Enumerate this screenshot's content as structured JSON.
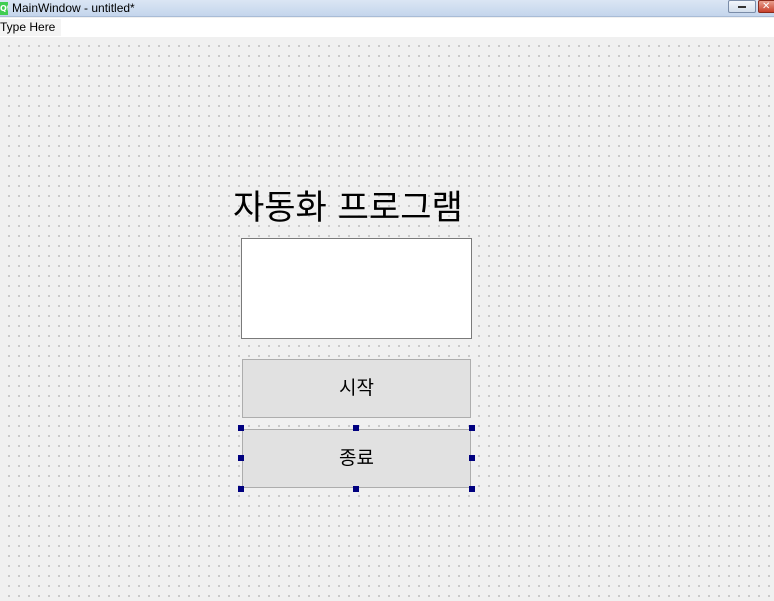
{
  "window": {
    "title": "MainWindow - untitled*",
    "app_icon_text": "Qt"
  },
  "menubar": {
    "placeholder_item": "Type Here"
  },
  "form": {
    "heading": "자동화 프로그램",
    "start_button": "시작",
    "exit_button": "종료"
  },
  "colors": {
    "selection_handle": "#00007f",
    "button_face": "#e1e1e1",
    "grid_dot": "#9a9a9a"
  }
}
